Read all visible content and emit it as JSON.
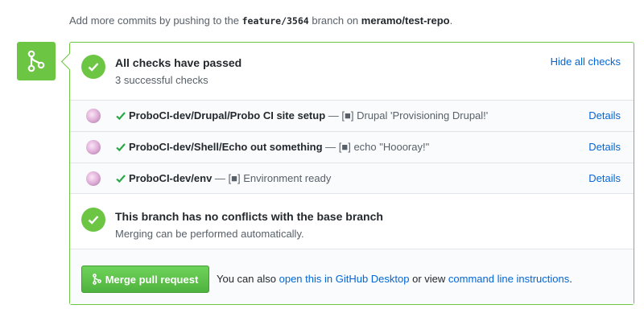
{
  "push_note": {
    "prefix": "Add more commits by pushing to the",
    "branch": "feature/3564",
    "middle": "branch on",
    "repo": "meramo/test-repo",
    "suffix": "."
  },
  "checks_summary": {
    "title": "All checks have passed",
    "subtitle": "3 successful checks",
    "hide_label": "Hide all checks"
  },
  "checks": [
    {
      "context": "ProboCI-dev/Drupal/Probo CI site setup",
      "description": "— [■] Drupal 'Provisioning Drupal!'",
      "details_label": "Details"
    },
    {
      "context": "ProboCI-dev/Shell/Echo out something",
      "description": "— [■] echo \"Hoooray!\"",
      "details_label": "Details"
    },
    {
      "context": "ProboCI-dev/env",
      "description": "— [■] Environment ready",
      "details_label": "Details"
    }
  ],
  "conflicts": {
    "title": "This branch has no conflicts with the base branch",
    "subtitle": "Merging can be performed automatically."
  },
  "merge": {
    "button_label": "Merge pull request",
    "alt_prefix": "You can also",
    "desktop_link": "open this in GitHub Desktop",
    "alt_middle": "or view",
    "cli_link": "command line instructions",
    "alt_suffix": "."
  },
  "colors": {
    "success": "#6cc644",
    "link": "#0366d6"
  }
}
